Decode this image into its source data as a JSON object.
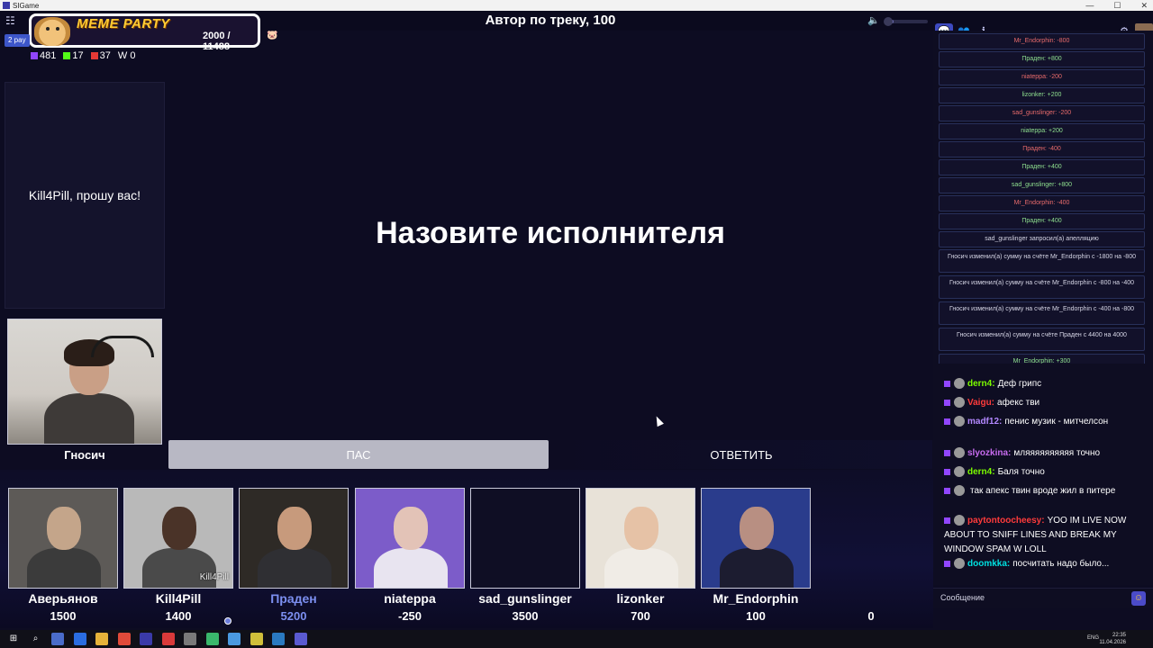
{
  "window": {
    "title": "SIGame",
    "controls": [
      "—",
      "☐",
      "✕"
    ]
  },
  "header": {
    "round_title": "Автор по треку, 100",
    "menu_icon": "menu-icon",
    "volume_icon": "speaker-icon",
    "volume_level": 0.2
  },
  "overlay": {
    "brand": "MEME PARTY",
    "progress": "2000 / 11488",
    "pig_icon": "pig-icon"
  },
  "mode_badge": "2 pay",
  "stats": [
    {
      "icon": "chat-icon",
      "value": "481"
    },
    {
      "icon": "kick-icon",
      "value": "17"
    },
    {
      "icon": "live-icon",
      "value": "37"
    },
    {
      "icon": "w-icon",
      "value": "0"
    }
  ],
  "presenter": {
    "message": "Kill4Pill, прошу вас!",
    "name": "Гносич"
  },
  "question": "Назовите исполнителя",
  "buttons": {
    "pass": "ПАС",
    "answer": "ОТВЕТИТЬ"
  },
  "players": [
    {
      "name": "Аверьянов",
      "score": "1500",
      "active": false,
      "skin": "#c4a58a",
      "shirt": "#3b3b3b",
      "bg": "#5d5a57"
    },
    {
      "name": "Kill4Pill",
      "score": "1400",
      "active": false,
      "skin": "#4a3328",
      "shirt": "#4a4a4a",
      "bg": "#b9b9b9",
      "cam_label": "Kill4Pill"
    },
    {
      "name": "Праден",
      "score": "5200",
      "active": true,
      "skin": "#c79a7c",
      "shirt": "#2f2f33",
      "bg": "#2e2a26"
    },
    {
      "name": "niateppa",
      "score": "-250",
      "active": false,
      "skin": "#e3c3b7",
      "shirt": "#e8e4f0",
      "bg": "#7c5cc9"
    },
    {
      "name": "sad_gunslinger",
      "score": "3500",
      "active": false,
      "skin": "",
      "shirt": "",
      "bg": "#0f0e24"
    },
    {
      "name": "lizonker",
      "score": "700",
      "active": false,
      "skin": "#e6c2a6",
      "shirt": "#f0ece6",
      "bg": "#e8e2d8"
    },
    {
      "name": "Mr_Endorphin",
      "score": "100",
      "active": false,
      "skin": "#b88f82",
      "shirt": "#1c1c30",
      "bg": "#2a3c8c"
    },
    {
      "name": "",
      "score": "0",
      "active": false,
      "skin": "",
      "shirt": "",
      "bg": ""
    }
  ],
  "sidebar": {
    "tabs": [
      "chat-icon",
      "users-icon",
      "info-icon",
      "settings-icon",
      "avatar"
    ],
    "log": [
      {
        "text": "Mr_Endorphin: -800",
        "color": "#e86b6b"
      },
      {
        "text": "Праден: +800",
        "color": "#8fe08f"
      },
      {
        "text": "niateppa: -200",
        "color": "#e86b6b"
      },
      {
        "text": "lizonker: +200",
        "color": "#8fe08f"
      },
      {
        "text": "sad_gunslinger: -200",
        "color": "#e86b6b"
      },
      {
        "text": "niateppa: +200",
        "color": "#8fe08f"
      },
      {
        "text": "Праден: -400",
        "color": "#e86b6b"
      },
      {
        "text": "Праден: +400",
        "color": "#8fe08f"
      },
      {
        "text": "sad_gunslinger: +800",
        "color": "#8fe08f"
      },
      {
        "text": "Mr_Endorphin: -400",
        "color": "#e86b6b"
      },
      {
        "text": "Праден: +400",
        "color": "#8fe08f"
      },
      {
        "text": "sad_gunslinger запросил(а) апелляцию",
        "color": "#d6d6e6"
      },
      {
        "text": "Гносич изменил(а) сумму на счёте Mr_Endorphin с -1800 на -800",
        "color": "#d6d6e6"
      },
      {
        "text": "Гносич изменил(а) сумму на счёте Mr_Endorphin с -800 на -400",
        "color": "#d6d6e6"
      },
      {
        "text": "Гносич изменил(а) сумму на счёте Mr_Endorphin с -400 на -800",
        "color": "#d6d6e6"
      },
      {
        "text": "Гносич изменил(а) сумму на счёте Праден с 4400 на 4000",
        "color": "#d6d6e6"
      },
      {
        "text": "Mr_Endorphin: +300",
        "color": "#8fe08f"
      }
    ],
    "chat": [
      {
        "user": "dern4:",
        "text": "Деф грипс",
        "color": "#7cfc00"
      },
      {
        "user": "Vaigu:",
        "text": "афекс тви",
        "color": "#ff3b3b"
      },
      {
        "user": "madf12:",
        "text": "пенис музик - митчелсон",
        "color": "#b388ff"
      },
      {
        "user": "slyozkina:",
        "text": "мляяяяяяяяяя точно",
        "color": "#c86cf0"
      },
      {
        "user": "dern4:",
        "text": "Баля точно",
        "color": "#7cfc00"
      },
      {
        "user": "",
        "text": "так апекс твин вроде жил в питере",
        "color": "#4a6cff"
      },
      {
        "user": "paytontoocheesy:",
        "text": "YOO IM LIVE NOW ABOUT TO SNIFF LINES AND BREAK MY WINDOW SPAM W LOLL",
        "color": "#ff3b3b"
      },
      {
        "user": "doomkka:",
        "text": "посчитать надо было...",
        "color": "#00e0e0"
      }
    ],
    "message_placeholder": "Сообщение",
    "emoji_icon": "smile-icon"
  },
  "taskbar": {
    "icons": [
      "windows-icon",
      "search-icon",
      "taskview-icon",
      "media-icon",
      "folder-icon",
      "chrome-icon",
      "sigame-icon",
      "opera-icon",
      "app-icon",
      "app-icon",
      "app-icon",
      "app-icon",
      "steam-icon",
      "sigame-icon"
    ],
    "lang": "ENG",
    "time": "22:35",
    "date": "11.04.2026"
  }
}
